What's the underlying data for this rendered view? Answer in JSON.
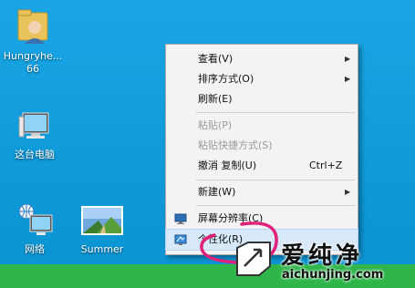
{
  "desktop": {
    "icons": [
      {
        "label": "Hungryhe... 66",
        "icon": "user-folder-icon"
      },
      {
        "label": "这台电脑",
        "icon": "computer-icon"
      },
      {
        "label": "网络",
        "icon": "network-icon"
      },
      {
        "label": "Summer",
        "icon": "image-file-icon"
      }
    ],
    "label_lines": {
      "folder_1": "Hungryhe...",
      "folder_2": "66"
    },
    "background_color": "#1aa6e6",
    "taskbar_color": "#2fb54a"
  },
  "context_menu": {
    "items": [
      {
        "label": "查看(V)",
        "submenu": true
      },
      {
        "label": "排序方式(O)",
        "submenu": true
      },
      {
        "label": "刷新(E)"
      },
      {
        "label": "粘贴(P)",
        "disabled": true
      },
      {
        "label": "粘贴快捷方式(S)",
        "disabled": true
      },
      {
        "label": "撤消 复制(U)",
        "shortcut": "Ctrl+Z"
      },
      {
        "label": "新建(W)",
        "submenu": true
      },
      {
        "label": "屏幕分辨率(C)",
        "icon": "display-resolution-icon"
      },
      {
        "label": "个性化(R)",
        "icon": "personalize-icon",
        "highlighted": true
      }
    ],
    "submenu_arrow": "▶"
  },
  "annotation": {
    "color": "#e0207a"
  },
  "watermark": {
    "title": "爱纯净",
    "url": "aichunjing.com"
  }
}
